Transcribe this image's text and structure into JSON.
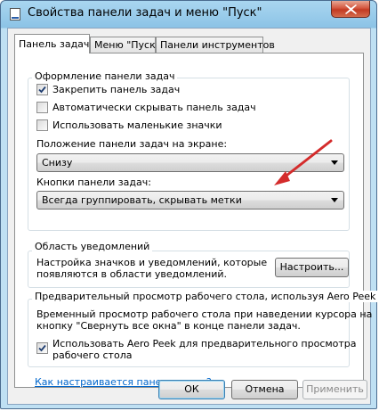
{
  "window": {
    "title": "Свойства панели задач и меню \"Пуск\""
  },
  "tabs": [
    {
      "label": "Панель задач"
    },
    {
      "label": "Меню \"Пуск\""
    },
    {
      "label": "Панели инструментов"
    }
  ],
  "appearance": {
    "title": "Оформление панели задач",
    "options": [
      {
        "label": "Закрепить панель задач",
        "checked": true
      },
      {
        "label": "Автоматически скрывать панель задач",
        "checked": false
      },
      {
        "label": "Использовать маленькие значки",
        "checked": false
      }
    ],
    "position_label": "Положение панели задач на экране:",
    "position_value": "Снизу",
    "buttons_label": "Кнопки панели задач:",
    "buttons_value": "Всегда группировать, скрывать метки"
  },
  "notify": {
    "title": "Область уведомлений",
    "desc_line1": "Настройка значков и уведомлений, которые",
    "desc_line2": "появляются в области уведомлений.",
    "customize_label": "Настроить..."
  },
  "peek": {
    "title": "Предварительный просмотр рабочего стола, используя Aero Peek",
    "desc_line1": "Временный просмотр рабочего стола при наведении курсора на",
    "desc_line2": "кнопку \"Свернуть все окна\" в конце панели задач.",
    "option_line1": "Использовать Aero Peek для предварительного просмотра",
    "option_line2": "рабочего стола",
    "option_checked": true
  },
  "help_link": "Как настраивается панель задач?",
  "footer": {
    "ok": "ОК",
    "cancel": "Отмена",
    "apply": "Применить"
  },
  "colors": {
    "arrow": "#d42b2b",
    "link": "#0066cc",
    "titlebar": "#a9d6f0"
  }
}
